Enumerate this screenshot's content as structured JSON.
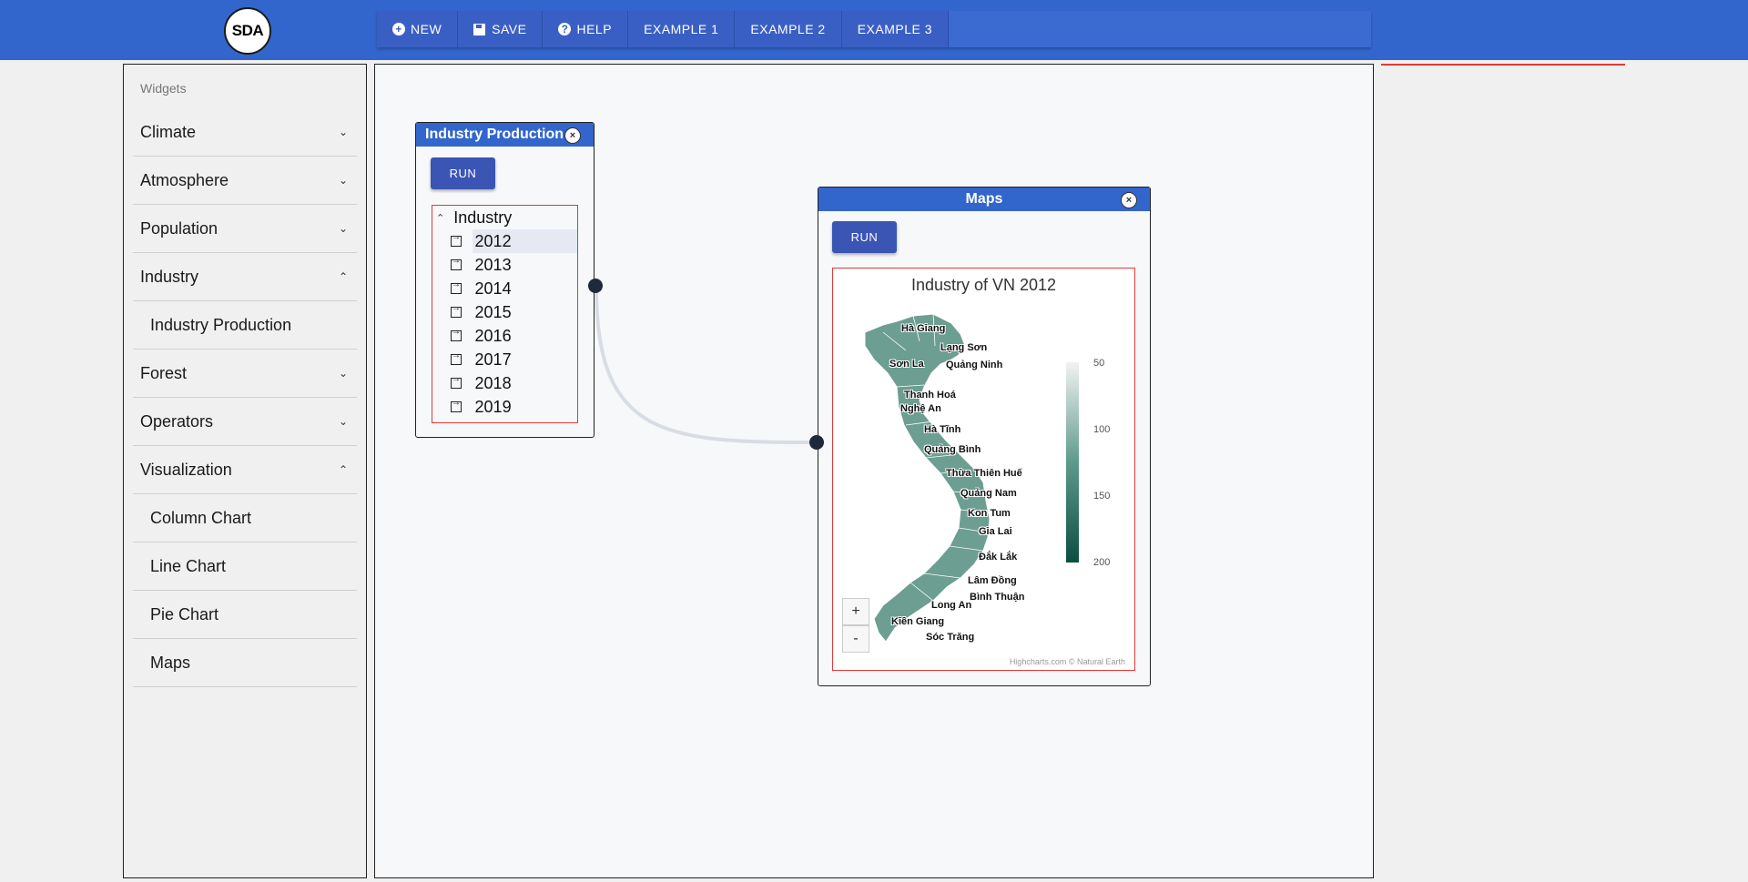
{
  "app": {
    "logo_text": "SDA"
  },
  "toolbar": {
    "buttons": [
      {
        "label": "NEW",
        "icon": "plus-circle-icon"
      },
      {
        "label": "SAVE",
        "icon": "save-icon"
      },
      {
        "label": "HELP",
        "icon": "help-circle-icon"
      },
      {
        "label": "EXAMPLE 1"
      },
      {
        "label": "EXAMPLE 2"
      },
      {
        "label": "EXAMPLE 3"
      }
    ]
  },
  "sidebar": {
    "heading": "Widgets",
    "groups": [
      {
        "label": "Climate",
        "expanded": false
      },
      {
        "label": "Atmosphere",
        "expanded": false
      },
      {
        "label": "Population",
        "expanded": false
      },
      {
        "label": "Industry",
        "expanded": true,
        "children": [
          "Industry Production"
        ]
      },
      {
        "label": "Forest",
        "expanded": false
      },
      {
        "label": "Operators",
        "expanded": false
      },
      {
        "label": "Visualization",
        "expanded": true,
        "children": [
          "Column Chart",
          "Line Chart",
          "Pie Chart",
          "Maps"
        ]
      }
    ]
  },
  "nodes": {
    "industry": {
      "title": "Industry Production",
      "run_label": "RUN",
      "tree_root": "Industry",
      "years": [
        "2012",
        "2013",
        "2014",
        "2015",
        "2016",
        "2017",
        "2018",
        "2019"
      ],
      "selected_year": "2012"
    },
    "maps": {
      "title": "Maps",
      "run_label": "RUN",
      "chart_title": "Industry of VN 2012",
      "credit": "Highcharts.com © Natural Earth",
      "zoom_in": "+",
      "zoom_out": "-",
      "legend_ticks": [
        "50",
        "100",
        "150",
        "200"
      ],
      "provinces": [
        "Hà Giang",
        "Lạng Sơn",
        "Sơn La",
        "Quảng Ninh",
        "Thanh Hoá",
        "Nghệ An",
        "Hà Tĩnh",
        "Quảng Bình",
        "Thừa Thiên Huế",
        "Quảng Nam",
        "Kon Tum",
        "Gia Lai",
        "Đắk Lắk",
        "Lâm Đồng",
        "Bình Thuận",
        "Long An",
        "Kiên Giang",
        "Sóc Trăng"
      ]
    }
  },
  "colors": {
    "header": "#3366cc",
    "button": "#3b55b5",
    "legend_low": "#f2f2f2",
    "legend_high": "#0b4f40"
  }
}
